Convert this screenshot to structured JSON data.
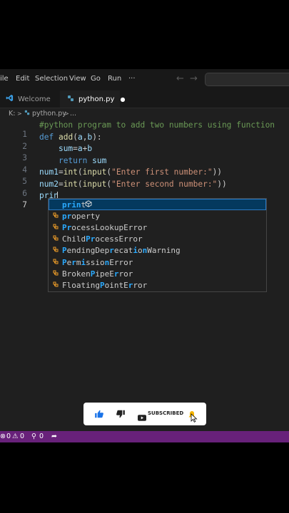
{
  "menubar": {
    "items": [
      "ile",
      "Edit",
      "Selection",
      "View",
      "Go",
      "Run",
      "···"
    ],
    "back_arrow": "←",
    "forward_arrow": "→"
  },
  "tabs": [
    {
      "label": "Welcome",
      "icon": "vscode-logo-icon",
      "color": "#3b9fe6"
    },
    {
      "label": "python.py",
      "icon": "python-icon",
      "color": "#519aba",
      "modified_dot": "●"
    }
  ],
  "breadcrumb": {
    "root": "K:",
    "file": "python.py",
    "sep1": ">",
    "sep2": ">",
    "more": "..."
  },
  "editor": {
    "lines": [
      {
        "num": "1",
        "text": "#python program to add two numbers using function"
      },
      {
        "num": "2",
        "text": "def add(a,b):"
      },
      {
        "num": "3",
        "text": "    sum=a+b"
      },
      {
        "num": "4",
        "text": "    return sum"
      },
      {
        "num": "5",
        "text": "num1=int(input(\"Enter first number:\"))"
      },
      {
        "num": "6",
        "text": "num2=int(input(\"Enter second number:\"))"
      },
      {
        "num": "7",
        "text": "prin"
      }
    ]
  },
  "suggestions": [
    {
      "label": "print",
      "kind": "function",
      "icon": "cube-icon"
    },
    {
      "label": "property",
      "kind": "class",
      "icon": "class-icon"
    },
    {
      "label": "ProcessLookupError",
      "kind": "class",
      "icon": "class-icon"
    },
    {
      "label": "ChildProcessError",
      "kind": "class",
      "icon": "class-icon"
    },
    {
      "label": "PendingDeprecationWarning",
      "kind": "class",
      "icon": "class-icon"
    },
    {
      "label": "PermissionError",
      "kind": "class",
      "icon": "class-icon"
    },
    {
      "label": "BrokenPipeError",
      "kind": "class",
      "icon": "class-icon"
    },
    {
      "label": "FloatingPointError",
      "kind": "class",
      "icon": "class-icon"
    }
  ],
  "statusbar": {
    "errors": "0",
    "warnings": "0",
    "ports": "0",
    "bg": "#68217a"
  },
  "youtube": {
    "subscribe": "SUBSCRIBED"
  },
  "colors": {
    "keyword": "#569cd6",
    "function": "#dcdcaa",
    "string": "#ce9178",
    "comment": "#6a9955",
    "variable": "#9cdcfe",
    "match": "#2aaaff"
  }
}
